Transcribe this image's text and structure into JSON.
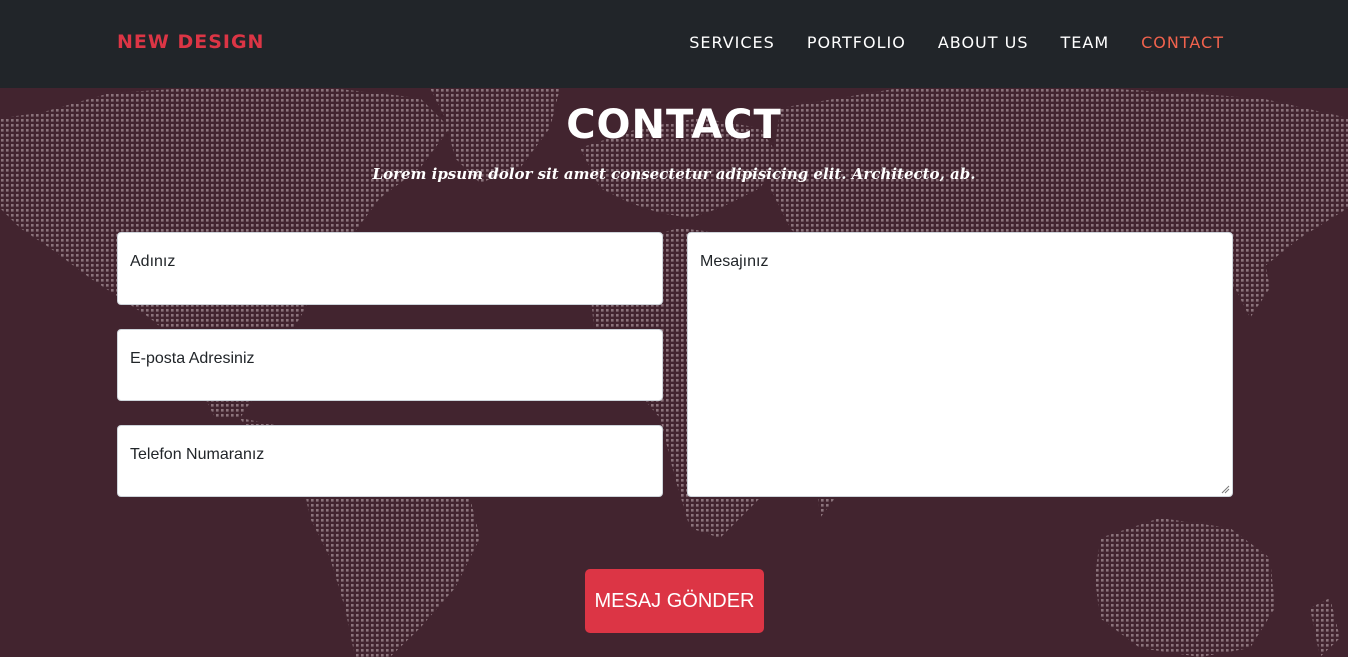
{
  "nav": {
    "brand": "NEW DESIGN",
    "links": [
      "SERVICES",
      "PORTFOLIO",
      "ABOUT US",
      "TEAM",
      "CONTACT"
    ],
    "active": "CONTACT"
  },
  "contact": {
    "title": "CONTACT",
    "subtitle": "Lorem ipsum dolor sit amet consectetur adipisicing elit. Architecto, ab.",
    "name_placeholder": "Adınız",
    "email_placeholder": "E-posta Adresiniz",
    "phone_placeholder": "Telefon Numaranız",
    "message_placeholder": "Mesajınız",
    "submit_label": "MESAJ GÖNDER"
  },
  "colors": {
    "navbar_bg": "#212529",
    "section_bg": "#42242f",
    "brand": "#dc3545",
    "nav_active": "#f0624d",
    "button": "#dc3545"
  }
}
